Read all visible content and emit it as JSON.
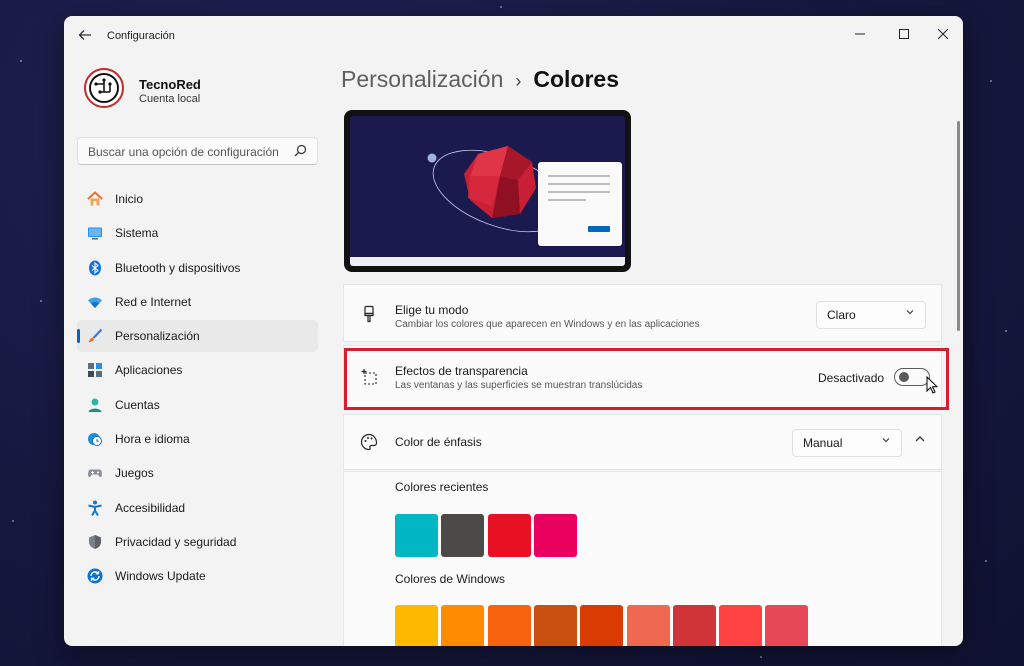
{
  "window": {
    "app_title": "Configuración",
    "back_icon": "arrow-left-icon",
    "controls": [
      "minimize-icon",
      "maximize-icon",
      "close-icon"
    ]
  },
  "profile": {
    "name": "TecnoRed",
    "account_type": "Cuenta local"
  },
  "search": {
    "placeholder": "Buscar una opción de configuración"
  },
  "sidebar": {
    "items": [
      {
        "label": "Inicio",
        "icon": "home-icon",
        "color": "#e8742b"
      },
      {
        "label": "Sistema",
        "icon": "monitor-icon",
        "color": "#0a74d2"
      },
      {
        "label": "Bluetooth y dispositivos",
        "icon": "bluetooth-icon",
        "color": "#1473d8"
      },
      {
        "label": "Red e Internet",
        "icon": "wifi-icon",
        "color": "#1a8be0"
      },
      {
        "label": "Personalización",
        "icon": "brush-icon",
        "color": "#e37a2d",
        "active": true
      },
      {
        "label": "Aplicaciones",
        "icon": "apps-icon",
        "color": "#4f6174"
      },
      {
        "label": "Cuentas",
        "icon": "person-icon",
        "color": "#2ab6a0"
      },
      {
        "label": "Hora e idioma",
        "icon": "clock-globe-icon",
        "color": "#1b8fd8"
      },
      {
        "label": "Juegos",
        "icon": "gamepad-icon",
        "color": "#7a7f88"
      },
      {
        "label": "Accesibilidad",
        "icon": "accessibility-icon",
        "color": "#1177d3"
      },
      {
        "label": "Privacidad y seguridad",
        "icon": "shield-icon",
        "color": "#6b6f76"
      },
      {
        "label": "Windows Update",
        "icon": "update-icon",
        "color": "#0a74d2"
      }
    ]
  },
  "header": {
    "parent": "Personalización",
    "separator": "›",
    "current": "Colores"
  },
  "mode": {
    "title": "Elige tu modo",
    "description": "Cambiar los colores que aparecen en Windows y en las aplicaciones",
    "value": "Claro"
  },
  "transparency": {
    "title": "Efectos de transparencia",
    "description": "Las ventanas y las superficies se muestran translúcidas",
    "state": "Desactivado",
    "on": false
  },
  "accent": {
    "title": "Color de énfasis",
    "value": "Manual",
    "recent_label": "Colores recientes",
    "recent_colors": [
      "#00b7c3",
      "#4c4a48",
      "#e81123",
      "#ea005e"
    ],
    "windows_label": "Colores de Windows",
    "windows_row1": [
      "#ffb900",
      "#ff8c00",
      "#f7630c",
      "#ca5010",
      "#da3b01",
      "#ef6950",
      "#d13438",
      "#ff4343",
      "#e74856"
    ],
    "windows_row2": [
      "#e81123",
      "#ea005e",
      "#c30052",
      "#e3008c",
      "#bf0077",
      "#c239b3",
      "#9a0089",
      "#0063b1",
      "#0078d7"
    ]
  }
}
